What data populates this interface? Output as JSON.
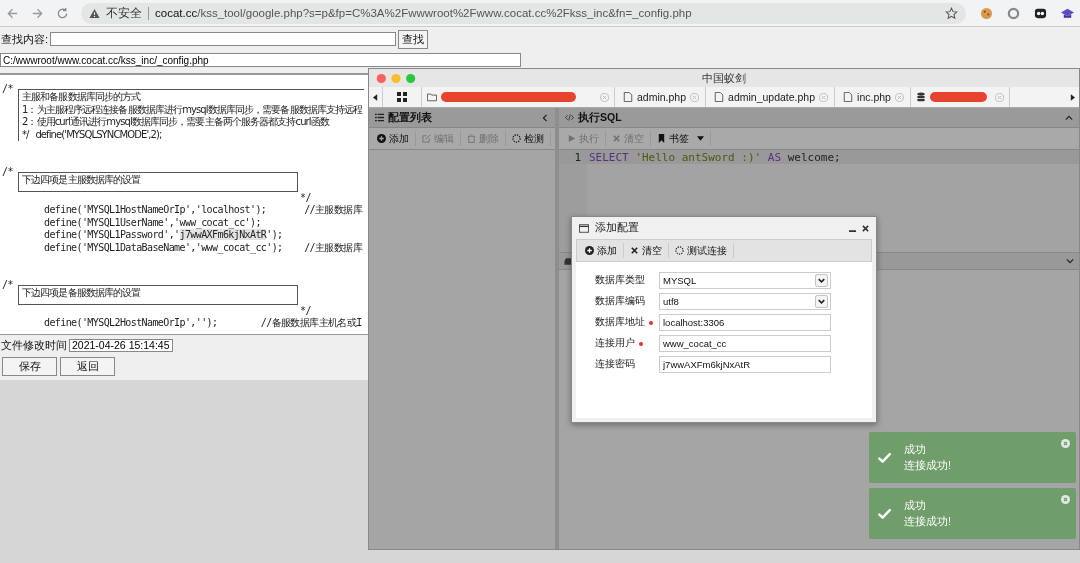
{
  "browser": {
    "warning": "不安全",
    "url_host": "cocat.cc",
    "url_path": "/kss_tool/google.php?s=p&fp=C%3A%2Fwwwroot%2Fwww.cocat.cc%2Fkss_inc&fn=_config.php"
  },
  "page": {
    "search_label": "查找内容:",
    "search_button": "查找",
    "path": "C:/wwwroot/www.cocat.cc/kss_inc/_config.php",
    "code": [
      {
        "kind": "box",
        "open": "/*",
        "lines": [
          "主服和备服数据库同步的方式",
          "1：为主服程序远程连接备服数据库进行mysql数据库同步，需要备服数据库支持远程",
          "2：使用curl通讯进行mysql数据库同步，需要主备两个服务器都支持curl函数",
          "*/   define('MYSQLSYNCMODE',2);"
        ]
      },
      {
        "kind": "blank"
      },
      {
        "kind": "blank"
      },
      {
        "kind": "box",
        "open": "/*",
        "lines": [
          "下边四项是主服数据库的设置"
        ],
        "close": "*/"
      },
      {
        "kind": "code",
        "text": "define('MYSQL1HostNameOrIp','localhost');       //主服数据库"
      },
      {
        "kind": "code",
        "text": "define('MYSQL1UserName','www_cocat_cc');"
      },
      {
        "kind": "code",
        "text": "define('MYSQL1Password','",
        "selected": "j7wwAXFm6kjNxAtR",
        "after": "');"
      },
      {
        "kind": "code",
        "text": "define('MYSQL1DataBaseName','www_cocat_cc');    //主服数据库"
      },
      {
        "kind": "blank"
      },
      {
        "kind": "blank"
      },
      {
        "kind": "box",
        "open": "/*",
        "lines": [
          "下边四项是备服数据库的设置"
        ],
        "close": "*/"
      },
      {
        "kind": "code",
        "text": "define('MYSQL2HostNameOrIp','');        //备服数据库主机名或I"
      }
    ],
    "mtime_label": "文件修改时间",
    "mtime": "2021-04-26 15:14:45",
    "buttons": [
      "保存",
      "返回"
    ]
  },
  "antsword": {
    "title": "中国蚁剑",
    "tabs": [
      {
        "kind": "home"
      },
      {
        "kind": "folder",
        "redacted": true
      },
      {
        "kind": "file",
        "label": "admin.php",
        "redacted": false
      },
      {
        "kind": "file",
        "label": "admin_update.php",
        "redacted": false
      },
      {
        "kind": "file",
        "label": "inc.php",
        "redacted": false
      },
      {
        "kind": "database",
        "redacted": true
      }
    ],
    "left_panel": {
      "title": "配置列表",
      "tools": [
        {
          "kind": "add",
          "label": "添加",
          "disabled": false
        },
        {
          "kind": "edit",
          "label": "编辑",
          "disabled": true
        },
        {
          "kind": "delete",
          "label": "删除",
          "disabled": true
        },
        {
          "kind": "test",
          "label": "检测",
          "disabled": false
        }
      ]
    },
    "sql_panel": {
      "title": "执行SQL",
      "tools": [
        {
          "kind": "run",
          "label": "执行",
          "disabled": true,
          "dropdown": false
        },
        {
          "kind": "clear",
          "label": "清空",
          "disabled": true,
          "dropdown": false
        },
        {
          "kind": "bookmark",
          "label": "书签",
          "disabled": false,
          "dropdown": true
        }
      ],
      "editor": [
        {
          "number": "1",
          "tokens": [
            {
              "kind": "keyword",
              "text": "SELECT"
            },
            {
              "kind": "string",
              "text": "'Hello antSword :)'"
            },
            {
              "kind": "keyword",
              "text": "AS"
            },
            {
              "kind": "plain",
              "text": "welcome;"
            }
          ]
        }
      ]
    },
    "dialog": {
      "title": "添加配置",
      "tools": [
        {
          "kind": "add",
          "label": "添加"
        },
        {
          "kind": "clear",
          "label": "清空"
        },
        {
          "kind": "test",
          "label": "测试连接"
        }
      ],
      "fields": [
        {
          "kind": "select",
          "label": "数据库类型",
          "value": "MYSQL",
          "required": false
        },
        {
          "kind": "select",
          "label": "数据库编码",
          "value": "utf8",
          "required": false
        },
        {
          "kind": "input",
          "label": "数据库地址",
          "value": "localhost:3306",
          "required": true
        },
        {
          "kind": "input",
          "label": "连接用户",
          "value": "www_cocat_cc",
          "required": true
        },
        {
          "kind": "input",
          "label": "连接密码",
          "value": "j7wwAXFm6kjNxAtR",
          "required": false
        }
      ]
    }
  },
  "toasts": [
    {
      "title": "成功",
      "message": "连接成功!"
    },
    {
      "title": "成功",
      "message": "连接成功!"
    }
  ]
}
